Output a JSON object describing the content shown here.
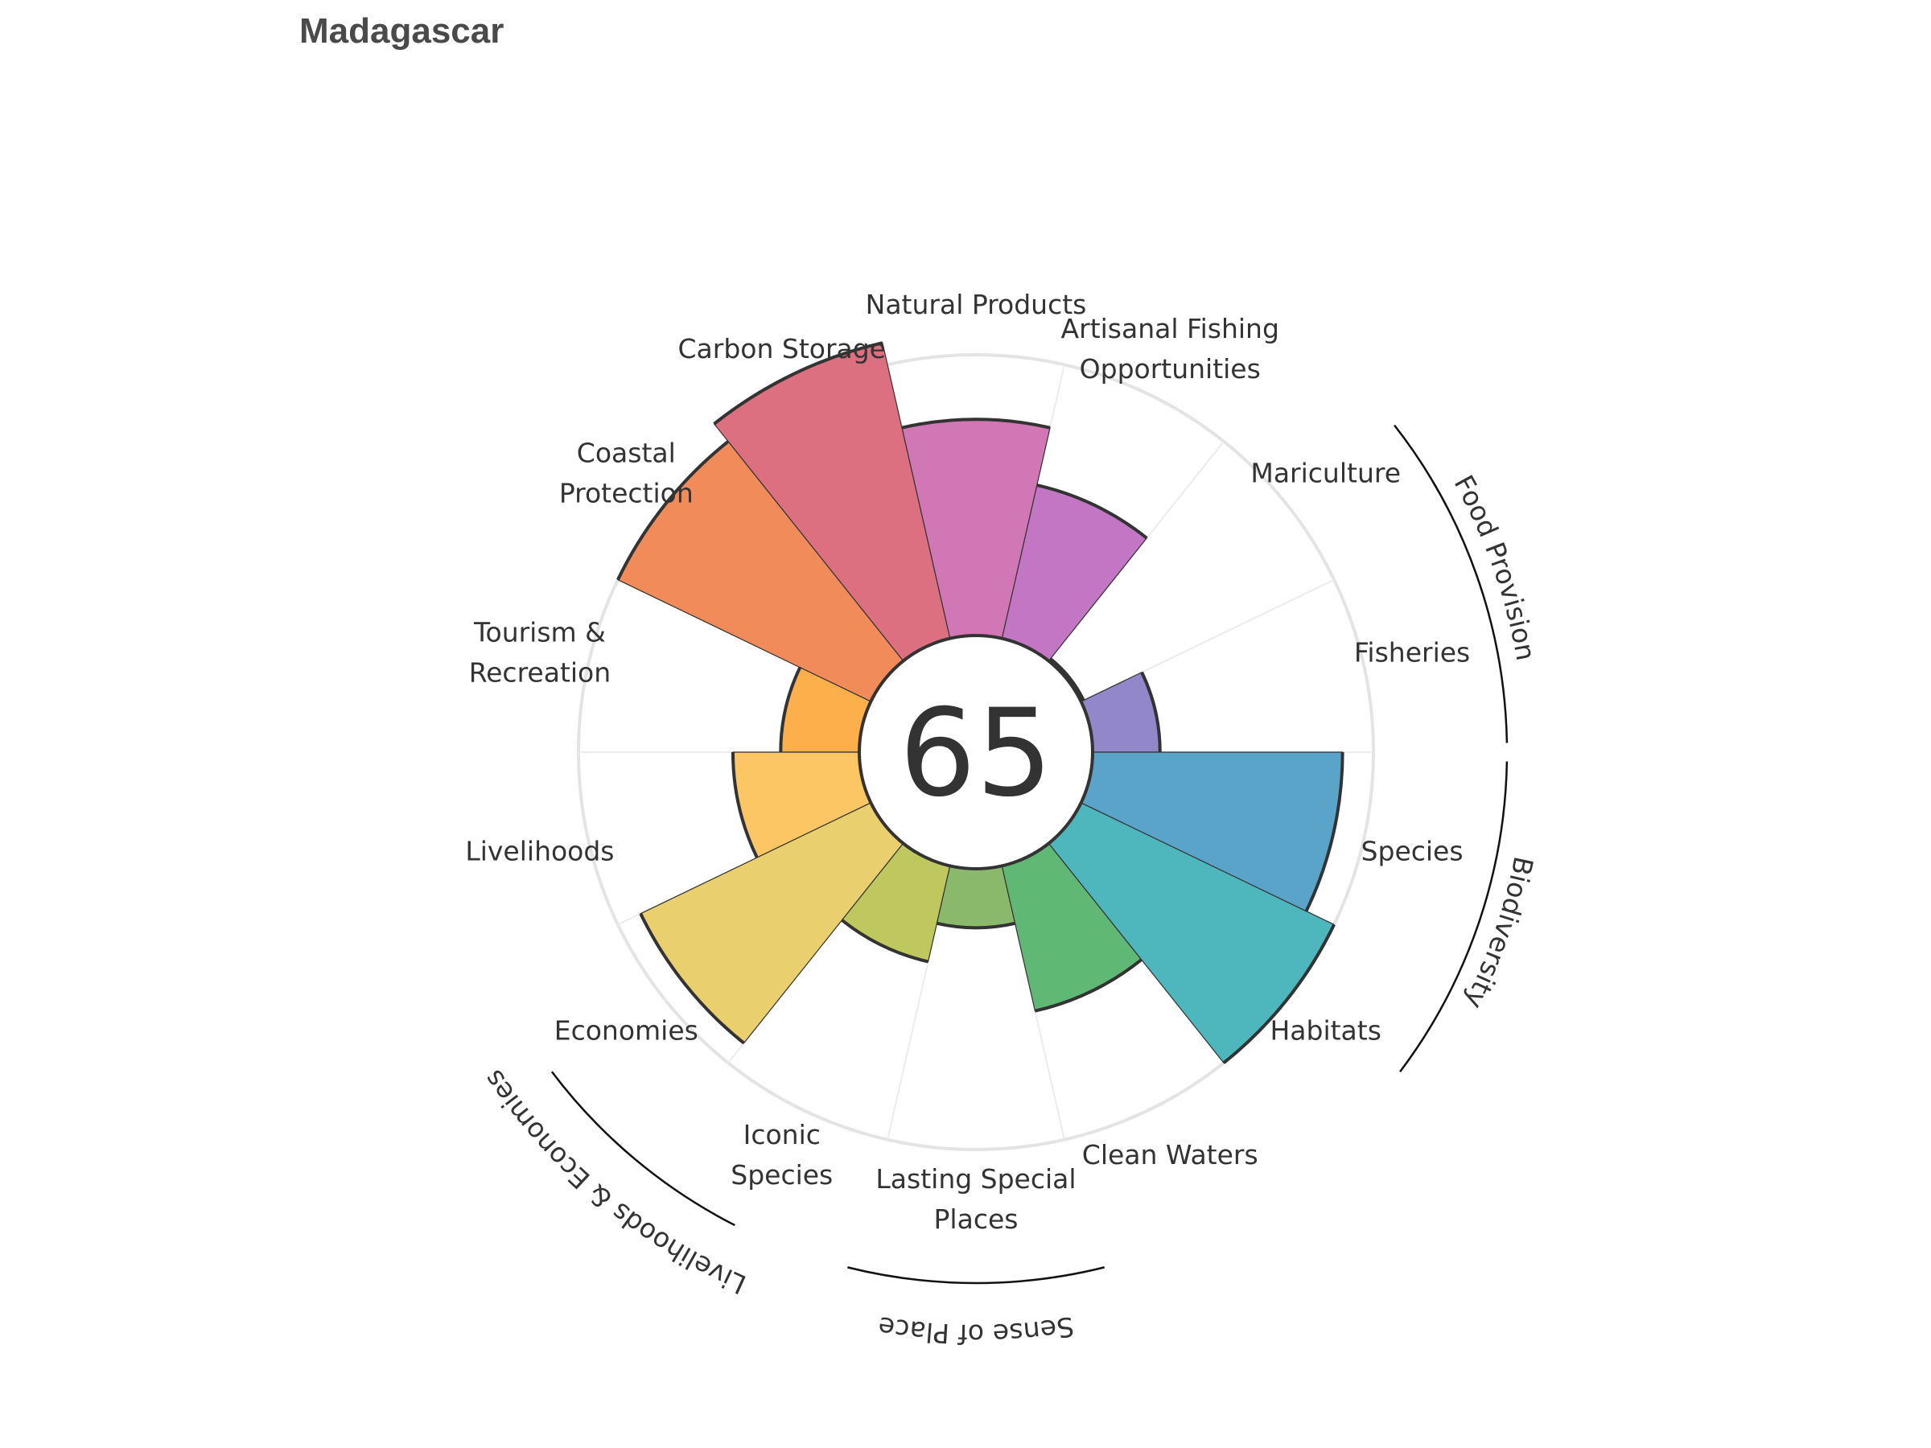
{
  "title": "Madagascar",
  "chart_data": {
    "type": "polar-bar",
    "title": "Madagascar",
    "center_score": "65",
    "rlim": [
      0,
      100
    ],
    "petals": [
      {
        "key": "fisheries",
        "label": [
          "Fisheries"
        ],
        "value": 24,
        "color": "#9187c9"
      },
      {
        "key": "mariculture",
        "label": [
          "Mariculture"
        ],
        "value": 1,
        "color": "#9a82c6"
      },
      {
        "key": "artisanal-fishing",
        "label": [
          "Artisanal Fishing",
          "Opportunities"
        ],
        "value": 56,
        "color": "#c276c4"
      },
      {
        "key": "natural-products",
        "label": [
          "Natural Products"
        ],
        "value": 77,
        "color": "#d277b6"
      },
      {
        "key": "carbon-storage",
        "label": [
          "Carbon Storage"
        ],
        "value": 108,
        "color": "#dd7080"
      },
      {
        "key": "coastal-protection",
        "label": [
          "Coastal",
          "Protection"
        ],
        "value": 100,
        "color": "#f18b59"
      },
      {
        "key": "tourism-recreation",
        "label": [
          "Tourism &",
          "Recreation"
        ],
        "value": 28,
        "color": "#fcaf4b"
      },
      {
        "key": "livelihoods",
        "label": [
          "Livelihoods"
        ],
        "value": 45,
        "color": "#fdc664"
      },
      {
        "key": "economies",
        "label": [
          "Economies"
        ],
        "value": 91,
        "color": "#e9cf6e"
      },
      {
        "key": "iconic-species",
        "label": [
          "Iconic",
          "Species"
        ],
        "value": 35,
        "color": "#bfc75f"
      },
      {
        "key": "lasting-special-places",
        "label": [
          "Lasting Special",
          "Places"
        ],
        "value": 21,
        "color": "#8bb96c"
      },
      {
        "key": "clean-waters",
        "label": [
          "Clean Waters"
        ],
        "value": 53,
        "color": "#5fb874"
      },
      {
        "key": "habitats",
        "label": [
          "Habitats"
        ],
        "value": 100,
        "color": "#4db7bd"
      },
      {
        "key": "species",
        "label": [
          "Species"
        ],
        "value": 89,
        "color": "#5aa3c9"
      }
    ],
    "groups": [
      {
        "key": "food-provision",
        "label": "Food Provision"
      },
      {
        "key": "biodiversity",
        "label": "Biodiversity"
      },
      {
        "key": "sense-of-place",
        "label": "Sense of Place"
      },
      {
        "key": "livelihoods-economies",
        "label": "Livelihoods & Economies"
      }
    ]
  }
}
